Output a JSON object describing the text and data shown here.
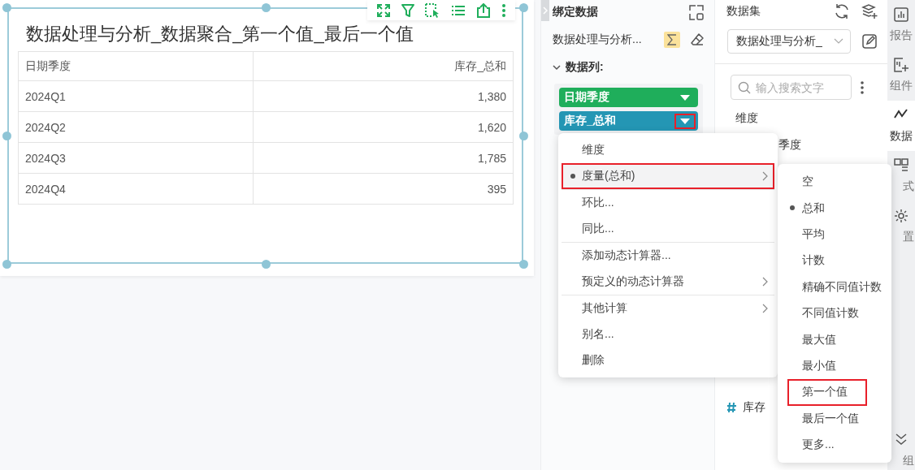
{
  "report_card": {
    "title": "数据处理与分析_数据聚合_第一个值_最后一个值",
    "selected": true,
    "table": {
      "columns": [
        "日期季度",
        "库存_总和"
      ],
      "rows": [
        [
          "2024Q1",
          "1,380"
        ],
        [
          "2024Q2",
          "1,620"
        ],
        [
          "2024Q3",
          "1,785"
        ],
        [
          "2024Q4",
          "395"
        ]
      ]
    }
  },
  "bind_panel": {
    "title": "绑定数据",
    "dataset_name": "数据处理与分析...",
    "aggregate_on": true,
    "section": {
      "label": "数据列:",
      "expanded": true
    },
    "fields": [
      {
        "label": "日期季度",
        "kind": "dimension",
        "highlighted": false
      },
      {
        "label": "库存_总和",
        "kind": "measure",
        "highlighted": true
      }
    ]
  },
  "dataset_panel": {
    "title": "数据集",
    "select": {
      "value": "数据处理与分析_"
    },
    "search": {
      "placeholder": "输入搜索文字"
    },
    "list": [
      {
        "kind": "heading",
        "label": "维度"
      },
      {
        "kind": "dimension",
        "label": "季度"
      },
      {
        "kind": "measure",
        "label": "库存"
      }
    ]
  },
  "side_tabs": [
    {
      "label": "报告",
      "selected": false
    },
    {
      "label": "组件",
      "selected": false
    },
    {
      "label": "数据",
      "selected": true
    },
    {
      "label": "式",
      "selected": false
    },
    {
      "label": "置",
      "selected": false
    },
    {
      "label": "组",
      "selected": false
    }
  ],
  "context_menu": {
    "items": [
      {
        "label": "维度",
        "checked": false,
        "submenu": false,
        "highlighted": false,
        "divider_before": false
      },
      {
        "label": "度量(总和)",
        "checked": true,
        "submenu": true,
        "highlighted": true,
        "divider_before": false
      },
      {
        "label": "环比...",
        "checked": false,
        "submenu": false,
        "highlighted": false,
        "divider_before": true
      },
      {
        "label": "同比...",
        "checked": false,
        "submenu": false,
        "highlighted": false,
        "divider_before": false
      },
      {
        "label": "添加动态计算器...",
        "checked": false,
        "submenu": false,
        "highlighted": false,
        "divider_before": true
      },
      {
        "label": "预定义的动态计算器",
        "checked": false,
        "submenu": true,
        "highlighted": false,
        "divider_before": false
      },
      {
        "label": "其他计算",
        "checked": false,
        "submenu": true,
        "highlighted": false,
        "divider_before": true
      },
      {
        "label": "别名...",
        "checked": false,
        "submenu": false,
        "highlighted": false,
        "divider_before": false
      },
      {
        "label": "删除",
        "checked": false,
        "submenu": false,
        "highlighted": false,
        "divider_before": false
      }
    ]
  },
  "submenu": {
    "items": [
      {
        "label": "空",
        "checked": false,
        "highlighted": false
      },
      {
        "label": "总和",
        "checked": true,
        "highlighted": false
      },
      {
        "label": "平均",
        "checked": false,
        "highlighted": false
      },
      {
        "label": "计数",
        "checked": false,
        "highlighted": false
      },
      {
        "label": "精确不同值计数",
        "checked": false,
        "highlighted": false
      },
      {
        "label": "不同值计数",
        "checked": false,
        "highlighted": false
      },
      {
        "label": "最大值",
        "checked": false,
        "highlighted": false
      },
      {
        "label": "最小值",
        "checked": false,
        "highlighted": false
      },
      {
        "label": "第一个值",
        "checked": false,
        "highlighted": true
      },
      {
        "label": "最后一个值",
        "checked": false,
        "highlighted": false
      },
      {
        "label": "更多...",
        "checked": false,
        "highlighted": false
      }
    ]
  }
}
